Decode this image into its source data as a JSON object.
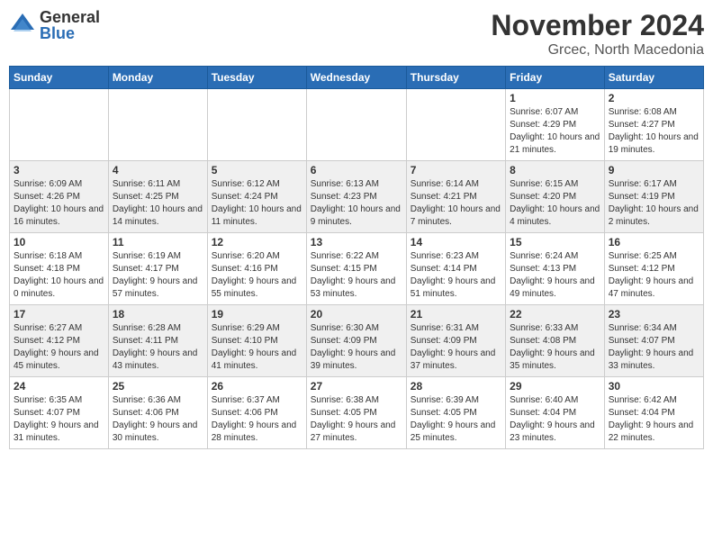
{
  "logo": {
    "general": "General",
    "blue": "Blue"
  },
  "title": {
    "month": "November 2024",
    "location": "Grcec, North Macedonia"
  },
  "headers": [
    "Sunday",
    "Monday",
    "Tuesday",
    "Wednesday",
    "Thursday",
    "Friday",
    "Saturday"
  ],
  "weeks": [
    [
      {
        "day": "",
        "info": ""
      },
      {
        "day": "",
        "info": ""
      },
      {
        "day": "",
        "info": ""
      },
      {
        "day": "",
        "info": ""
      },
      {
        "day": "",
        "info": ""
      },
      {
        "day": "1",
        "info": "Sunrise: 6:07 AM\nSunset: 4:29 PM\nDaylight: 10 hours and 21 minutes."
      },
      {
        "day": "2",
        "info": "Sunrise: 6:08 AM\nSunset: 4:27 PM\nDaylight: 10 hours and 19 minutes."
      }
    ],
    [
      {
        "day": "3",
        "info": "Sunrise: 6:09 AM\nSunset: 4:26 PM\nDaylight: 10 hours and 16 minutes."
      },
      {
        "day": "4",
        "info": "Sunrise: 6:11 AM\nSunset: 4:25 PM\nDaylight: 10 hours and 14 minutes."
      },
      {
        "day": "5",
        "info": "Sunrise: 6:12 AM\nSunset: 4:24 PM\nDaylight: 10 hours and 11 minutes."
      },
      {
        "day": "6",
        "info": "Sunrise: 6:13 AM\nSunset: 4:23 PM\nDaylight: 10 hours and 9 minutes."
      },
      {
        "day": "7",
        "info": "Sunrise: 6:14 AM\nSunset: 4:21 PM\nDaylight: 10 hours and 7 minutes."
      },
      {
        "day": "8",
        "info": "Sunrise: 6:15 AM\nSunset: 4:20 PM\nDaylight: 10 hours and 4 minutes."
      },
      {
        "day": "9",
        "info": "Sunrise: 6:17 AM\nSunset: 4:19 PM\nDaylight: 10 hours and 2 minutes."
      }
    ],
    [
      {
        "day": "10",
        "info": "Sunrise: 6:18 AM\nSunset: 4:18 PM\nDaylight: 10 hours and 0 minutes."
      },
      {
        "day": "11",
        "info": "Sunrise: 6:19 AM\nSunset: 4:17 PM\nDaylight: 9 hours and 57 minutes."
      },
      {
        "day": "12",
        "info": "Sunrise: 6:20 AM\nSunset: 4:16 PM\nDaylight: 9 hours and 55 minutes."
      },
      {
        "day": "13",
        "info": "Sunrise: 6:22 AM\nSunset: 4:15 PM\nDaylight: 9 hours and 53 minutes."
      },
      {
        "day": "14",
        "info": "Sunrise: 6:23 AM\nSunset: 4:14 PM\nDaylight: 9 hours and 51 minutes."
      },
      {
        "day": "15",
        "info": "Sunrise: 6:24 AM\nSunset: 4:13 PM\nDaylight: 9 hours and 49 minutes."
      },
      {
        "day": "16",
        "info": "Sunrise: 6:25 AM\nSunset: 4:12 PM\nDaylight: 9 hours and 47 minutes."
      }
    ],
    [
      {
        "day": "17",
        "info": "Sunrise: 6:27 AM\nSunset: 4:12 PM\nDaylight: 9 hours and 45 minutes."
      },
      {
        "day": "18",
        "info": "Sunrise: 6:28 AM\nSunset: 4:11 PM\nDaylight: 9 hours and 43 minutes."
      },
      {
        "day": "19",
        "info": "Sunrise: 6:29 AM\nSunset: 4:10 PM\nDaylight: 9 hours and 41 minutes."
      },
      {
        "day": "20",
        "info": "Sunrise: 6:30 AM\nSunset: 4:09 PM\nDaylight: 9 hours and 39 minutes."
      },
      {
        "day": "21",
        "info": "Sunrise: 6:31 AM\nSunset: 4:09 PM\nDaylight: 9 hours and 37 minutes."
      },
      {
        "day": "22",
        "info": "Sunrise: 6:33 AM\nSunset: 4:08 PM\nDaylight: 9 hours and 35 minutes."
      },
      {
        "day": "23",
        "info": "Sunrise: 6:34 AM\nSunset: 4:07 PM\nDaylight: 9 hours and 33 minutes."
      }
    ],
    [
      {
        "day": "24",
        "info": "Sunrise: 6:35 AM\nSunset: 4:07 PM\nDaylight: 9 hours and 31 minutes."
      },
      {
        "day": "25",
        "info": "Sunrise: 6:36 AM\nSunset: 4:06 PM\nDaylight: 9 hours and 30 minutes."
      },
      {
        "day": "26",
        "info": "Sunrise: 6:37 AM\nSunset: 4:06 PM\nDaylight: 9 hours and 28 minutes."
      },
      {
        "day": "27",
        "info": "Sunrise: 6:38 AM\nSunset: 4:05 PM\nDaylight: 9 hours and 27 minutes."
      },
      {
        "day": "28",
        "info": "Sunrise: 6:39 AM\nSunset: 4:05 PM\nDaylight: 9 hours and 25 minutes."
      },
      {
        "day": "29",
        "info": "Sunrise: 6:40 AM\nSunset: 4:04 PM\nDaylight: 9 hours and 23 minutes."
      },
      {
        "day": "30",
        "info": "Sunrise: 6:42 AM\nSunset: 4:04 PM\nDaylight: 9 hours and 22 minutes."
      }
    ]
  ]
}
